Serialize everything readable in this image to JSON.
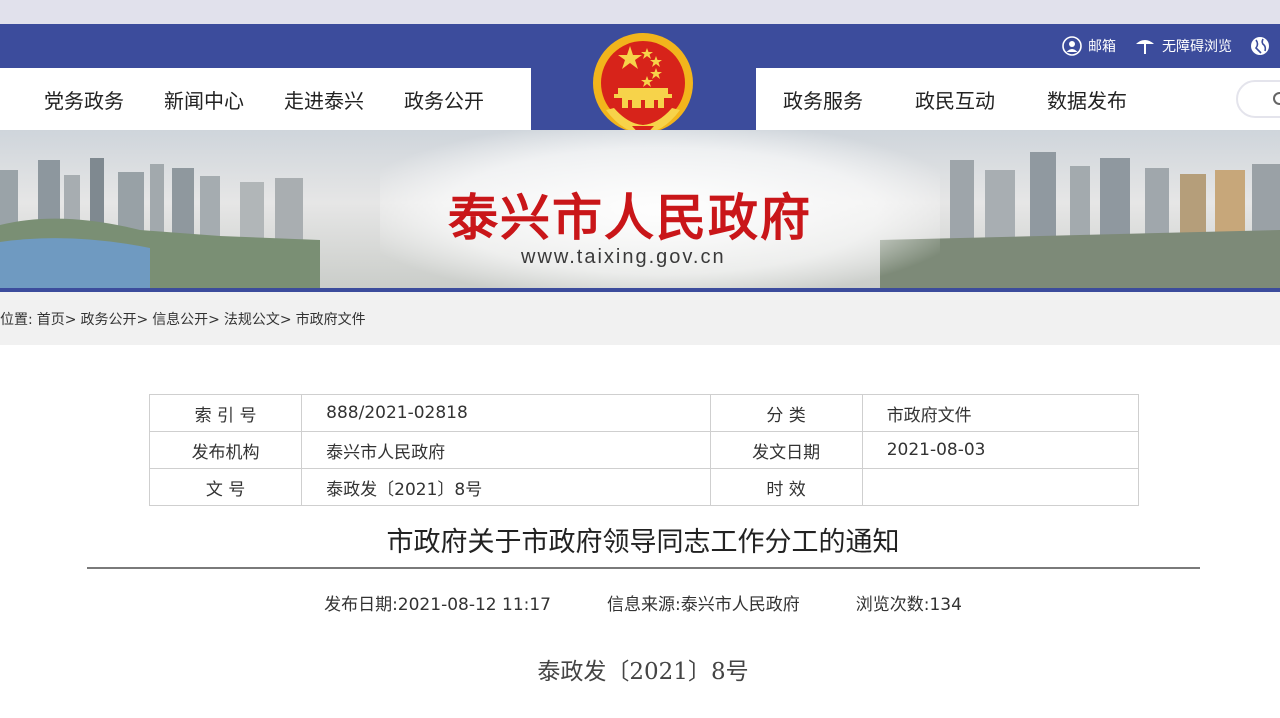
{
  "header": {
    "util_links": [
      {
        "label": "邮箱",
        "icon": "user-icon"
      },
      {
        "label": "无障碍浏览",
        "icon": "accessibility-icon"
      },
      {
        "label": "",
        "icon": "globe-icon"
      }
    ],
    "nav_left": [
      "党务政务",
      "新闻中心",
      "走进泰兴",
      "政务公开"
    ],
    "nav_right": [
      "政务服务",
      "政民互动",
      "数据发布"
    ],
    "colors": {
      "primary": "#3c4c9c",
      "accent": "#c91619",
      "gold": "#f2b51c"
    }
  },
  "banner": {
    "site_name": "泰兴市人民政府",
    "site_url": "www.taixing.gov.cn"
  },
  "breadcrumb": {
    "prefix": "位置:",
    "items": [
      "首页>",
      "政务公开>",
      "信息公开>",
      "法规公文>",
      "市政府文件"
    ]
  },
  "info_table": {
    "rows": [
      {
        "k1": "索 引 号",
        "v1": "888/2021-02818",
        "k2": "分 类",
        "v2": "市政府文件"
      },
      {
        "k1": "发布机构",
        "v1": "泰兴市人民政府",
        "k2": "发文日期",
        "v2": "2021-08-03"
      },
      {
        "k1": "文 号",
        "v1": "泰政发〔2021〕8号",
        "k2": "时 效",
        "v2": ""
      }
    ]
  },
  "article": {
    "title": "市政府关于市政府领导同志工作分工的通知",
    "publish_date": "发布日期:2021-08-12 11:17",
    "source": "信息来源:泰兴市人民政府",
    "views": "浏览次数:134",
    "doc_number": "泰政发〔2021〕8号"
  }
}
